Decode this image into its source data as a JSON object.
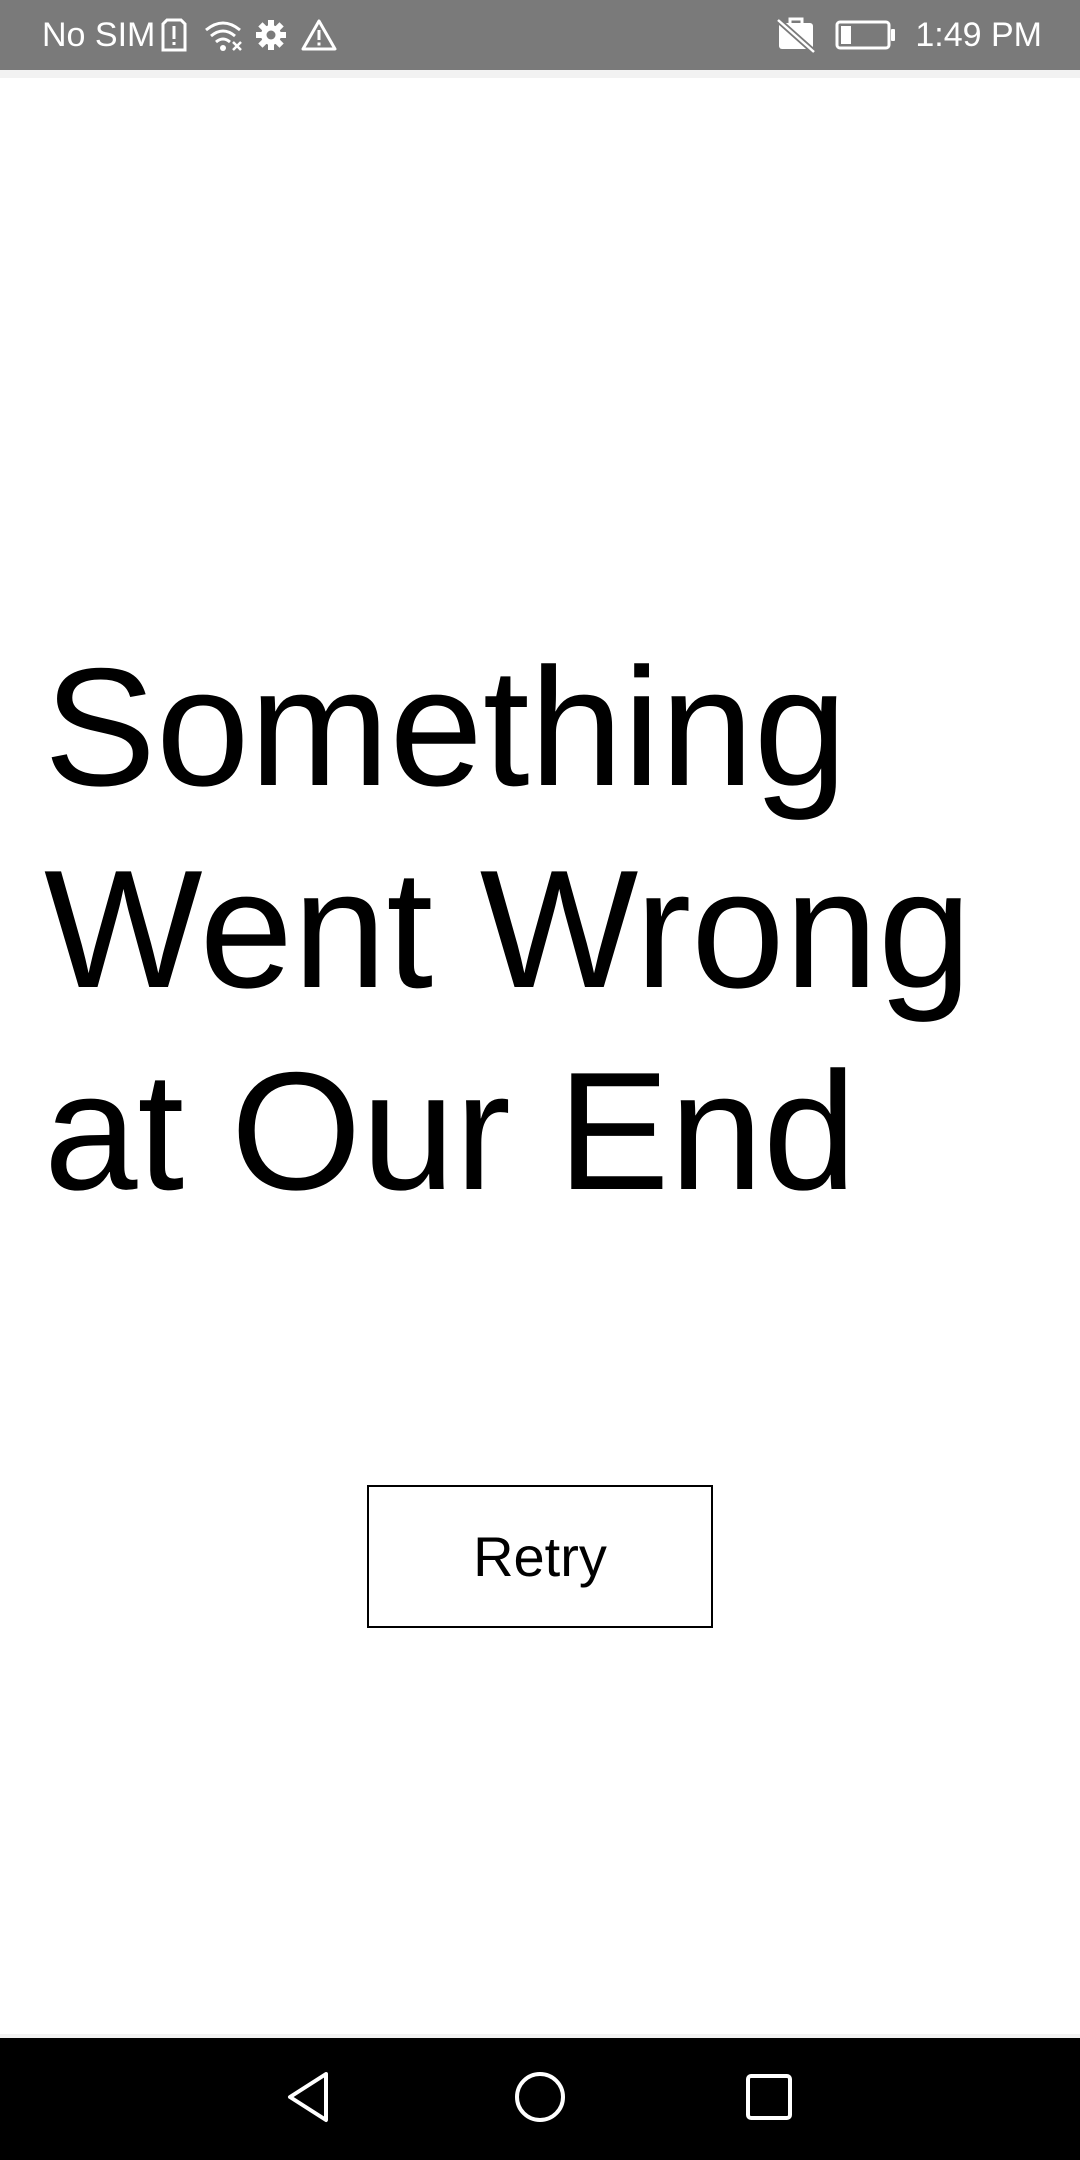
{
  "status_bar": {
    "carrier": "No SIM",
    "time": "1:49 PM",
    "icons": [
      "sim-alert-icon",
      "wifi-icon",
      "settings-gear-icon",
      "warning-icon",
      "no-sim-card-icon",
      "battery-icon"
    ]
  },
  "error_screen": {
    "title": "Something Went Wrong at Our End",
    "retry_label": "Retry"
  },
  "nav_bar": {
    "buttons": [
      "back-icon",
      "home-icon",
      "recents-icon"
    ]
  },
  "colors": {
    "status_bar_bg": "#7a7a7a",
    "nav_bar_bg": "#000000",
    "background": "#ffffff",
    "text": "#000000"
  }
}
